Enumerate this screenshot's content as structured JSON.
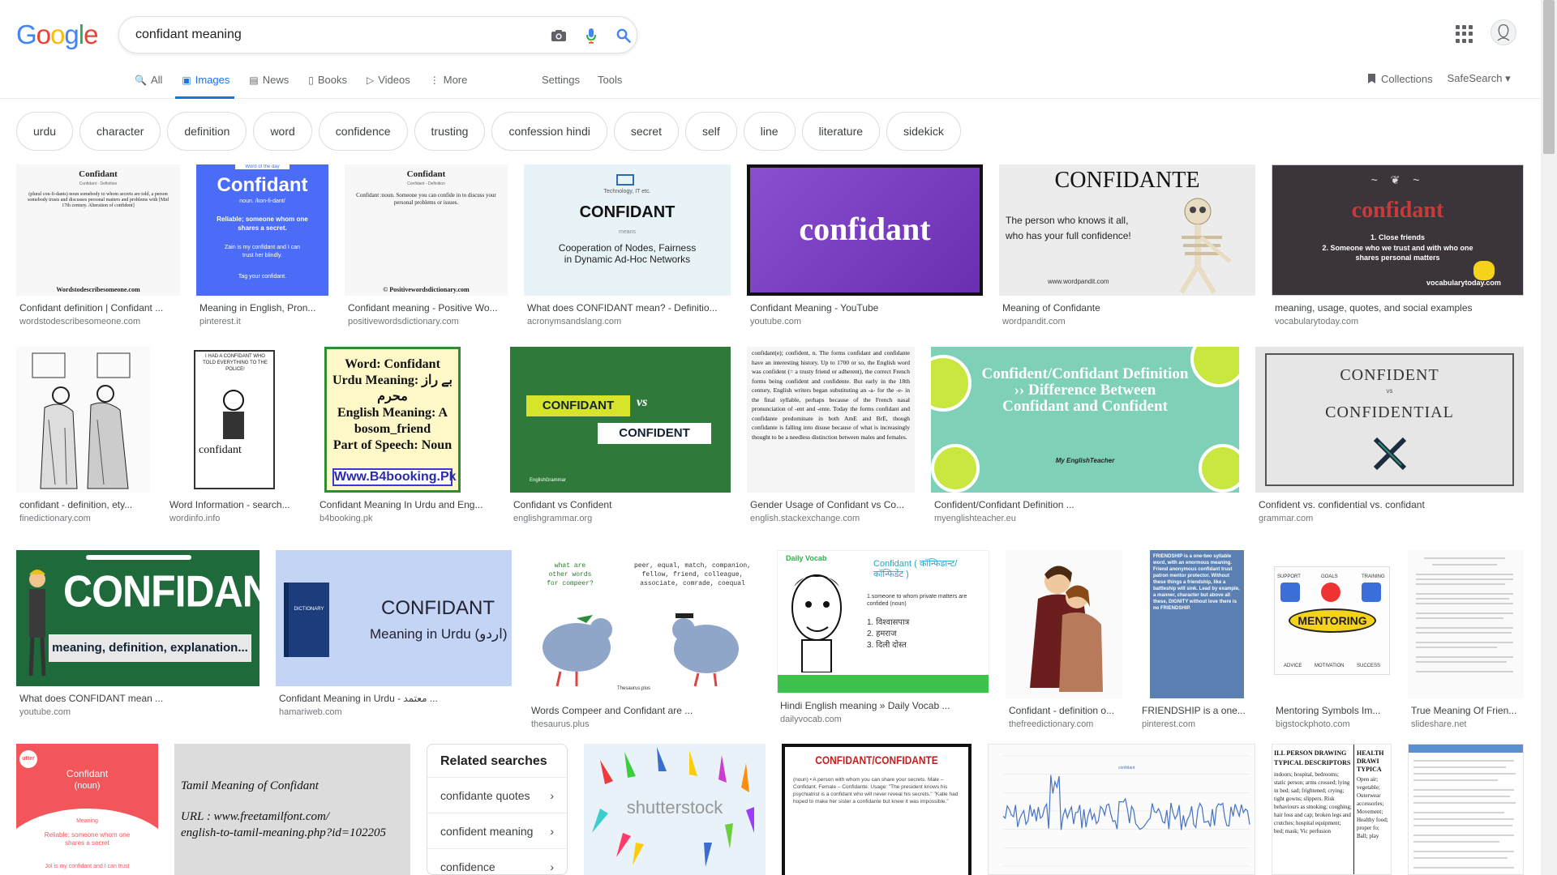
{
  "logo": {
    "G": "G",
    "o1": "o",
    "o2": "o",
    "g": "g",
    "l": "l",
    "e": "e"
  },
  "search": {
    "value": "confidant meaning"
  },
  "tabs": [
    {
      "label": "All",
      "icon": "🔍"
    },
    {
      "label": "Images",
      "icon": "▣"
    },
    {
      "label": "News",
      "icon": "▤"
    },
    {
      "label": "Books",
      "icon": "▯"
    },
    {
      "label": "Videos",
      "icon": "▷"
    },
    {
      "label": "More",
      "icon": "⋮"
    }
  ],
  "tools": {
    "settings": "Settings",
    "tools": "Tools"
  },
  "right": {
    "collections": "Collections",
    "safesearch": "SafeSearch ▾"
  },
  "chips": [
    "urdu",
    "character",
    "definition",
    "word",
    "confidence",
    "trusting",
    "confession hindi",
    "secret",
    "self",
    "line",
    "literature",
    "sidekick"
  ],
  "results": [
    {
      "caption": "Confidant definition | Confidant ...",
      "source": "wordstodescribesomeone.com"
    },
    {
      "caption": "Meaning in English, Pron...",
      "source": "pinterest.it"
    },
    {
      "caption": "Confidant meaning - Positive Wo...",
      "source": "positivewordsdictionary.com"
    },
    {
      "caption": "What does CONFIDANT mean? - Definitio...",
      "source": "acronymsandslang.com"
    },
    {
      "caption": "Confidant Meaning - YouTube",
      "source": "youtube.com"
    },
    {
      "caption": "Meaning of Confidante",
      "source": "wordpandit.com"
    },
    {
      "caption": "meaning, usage, quotes, and social examples",
      "source": "vocabularytoday.com"
    },
    {
      "caption": "confidant - definition, ety...",
      "source": "finedictionary.com"
    },
    {
      "caption": "Word Information - search...",
      "source": "wordinfo.info"
    },
    {
      "caption": "Confidant Meaning In Urdu and Eng...",
      "source": "b4booking.pk"
    },
    {
      "caption": "Confidant vs Confident",
      "source": "englishgrammar.org"
    },
    {
      "caption": "Gender Usage of Confidant vs Co...",
      "source": "english.stackexchange.com"
    },
    {
      "caption": "Confident/Confidant Definition ...",
      "source": "myenglishteacher.eu"
    },
    {
      "caption": "Confident vs. confidential vs. confidant",
      "source": "grammar.com"
    },
    {
      "caption": "What does CONFIDANT mean ...",
      "source": "youtube.com"
    },
    {
      "caption": "Confidant Meaning in Urdu - معتمد ...",
      "source": "hamariweb.com"
    },
    {
      "caption": "Words Compeer and Confidant are ...",
      "source": "thesaurus.plus"
    },
    {
      "caption": "Hindi English meaning » Daily Vocab ...",
      "source": "dailyvocab.com"
    },
    {
      "caption": "Confidant - definition o...",
      "source": "thefreedictionary.com"
    },
    {
      "caption": "FRIENDSHIP is a one...",
      "source": "pinterest.com"
    },
    {
      "caption": "Mentoring Symbols Im...",
      "source": "bigstockphoto.com"
    },
    {
      "caption": "True Meaning Of Frien...",
      "source": "slideshare.net"
    }
  ],
  "thumbs": {
    "t1_title": "Confidant",
    "t1_sub": "Confidant - Definition",
    "t1_body": "(plural con-fi-dants) noun somebody to whom secrets are told, a person somebody trusts and discusses personal matters and problems with [Mid 17th century. Alteration of confident]",
    "t1_foot": "Wordstodescribesomeone.com",
    "t2_badge": "Word of the day",
    "t2_title": "Confidant",
    "t2_pron": "noun. /kon-fi-dant/",
    "t2_def": "Reliable; someone whom one shares a secret.",
    "t2_ex": "Zain is my confidant and I can trust her blindly.",
    "t2_tag": "Tag your confidant.",
    "t3_title": "Confidant",
    "t3_sub": "Confidant - Definition",
    "t3_body": "Confidant :noun. Someone you can confide in to discuss your personal problems or issues.",
    "t3_foot": "© Positivewordsdictionary.com",
    "t4_top": "Technology, IT etc.",
    "t4_title": "CONFIDANT",
    "t4_means": "means",
    "t4_body": "Cooperation of Nodes, Fairness in Dynamic Ad-Hoc Networks",
    "t5_title": "confidant",
    "t6_title": "CONFIDANTE",
    "t6_body": "The person who knows it all, who has your full confidence!",
    "t6_url": "www.wordpandit.com",
    "t7_title": "confidant",
    "t7_l1": "1. Close friends",
    "t7_l2": "2. Someone who we trust and with who one shares personal matters",
    "t7_url": "vocabularytoday.com",
    "t9_text": "I HAD A CONFIDANT WHO TOLD EVERYTHING TO THE POLICE!",
    "t9_word": "confidant",
    "t10_l1": "Word: Confidant",
    "t10_l2": "Urdu Meaning: بے راز محرم",
    "t10_l3": "English Meaning: A bosom_friend",
    "t10_l4": "Part of Speech: Noun",
    "t10_url": "Www.B4booking.Pk",
    "t11_a": "CONFIDANT",
    "t11_vs": "vs",
    "t11_b": "CONFIDENT",
    "t11_logo": "EnglishGrammar",
    "t12_body": "confidant(e); confident, n. The forms confidant and confidante have an interesting history. Up to 1700 or so, the English word was confident (= a trusty friend or adherent), the correct French forms being confident and confidente. But early in the 18th century, English writers began substituting an -a- for the -e- in the final syllable, perhaps because of the French nasal pronunciation of -ent and -ente. Today the forms confidant and confidante predominate in both AmE and BrE, though confidante is falling into disuse because of what is increasingly thought to be a needless distinction between males and females.",
    "t13_title": "Confident/Confidant Definition ›› Difference Between Confidant and Confident",
    "t13_logo": "My EnglishTeacher",
    "t14_a": "CONFIDENT",
    "t14_vs": "vs",
    "t14_b": "CONFIDENTIAL",
    "t15_title": "CONFIDANT",
    "t15_sub": "meaning, definition, explanation...",
    "t16_book": "DICTIONARY",
    "t16_title": "CONFIDANT",
    "t16_sub": "Meaning in Urdu (اردو)",
    "t17_left": "what are other words for compeer?",
    "t17_right": "peer, equal, match, companion, fellow, friend, colleague, associate, comrade, coequal",
    "t17_brand": "Thesaurus.plus",
    "t18_vocab": "Daily Vocab",
    "t18_title": "Confidant ( कॉन्फिडान्ट/कॉन्फिडेंट )",
    "t18_body": "1.someone to whom private matters are confided (noun)",
    "t18_h1": "1. विश्वासपात्र",
    "t18_h2": "2. हमराज",
    "t18_h3": "3. दिली दोस्त",
    "t20_text": "FRIENDSHIP is a one-two syllable word, with an enormous meaning. Friend anonymous confidant trust patron mentor protector. Without these things a friendship, like a battleship will sink. Lead by example, a manner, character but above all these, DIGNITY without love there is no FRIENDSHIP.",
    "t21_word": "MENTORING",
    "t21_a": "SUPPORT",
    "t21_b": "GOALS",
    "t21_c": "TRAINING",
    "t21_d": "ADVICE",
    "t21_e": "MOTIVATION",
    "t21_f": "SUCCESS",
    "t23_brand": "utter",
    "t23_title": "Confidant",
    "t23_noun": "(noun)",
    "t23_meaning": "Meaning",
    "t23_def": "Reliable; someone whom one shares a secret",
    "t23_ex": "Jol is my confidant and I can trust",
    "t24_l1": "Tamil Meaning of Confidant",
    "t24_l2": "URL : www.freetamilfont.com/",
    "t24_l3": "english-to-tamil-meaning.php?id=102205",
    "t25_brand": "shutterstock",
    "t26_title": "CONFIDANT/CONFIDANTE",
    "t26_body": "(noun) • A person with whom you can share your secrets. Male – Confidant. Female – Confidante. Usage: \"The president knows his psychiatrist is a confidant who will never reveal his secrets.\" \"Katie had hoped to make her sister a confidante but knew it was impossible.\"",
    "t28_l1": "ILL PERSON DRAWING",
    "t28_l2": "TYPICAL DESCRIPTORS",
    "t28_body": "indoors; hospital, bedrooms; static person; arms crossed; lying in bed; sad; frightened; crying; tight gowns; slippers. Risk behaviours as smoking; coughing; hair loss and cap; broken legs and crutches; hospital equipment; bed; mask; Vic perfusion",
    "t28_r1": "HEALTH",
    "t28_r2": "DRAWI",
    "t28_r3": "TYPICA",
    "t28_rb": "Open air; vegetable; Outerwear accessories; Movement; Healthy food; proper fo; Ball; play"
  },
  "related": {
    "title": "Related searches",
    "items": [
      "confidante quotes",
      "confident meaning",
      "confidence"
    ]
  },
  "chart_legend": "confidant"
}
